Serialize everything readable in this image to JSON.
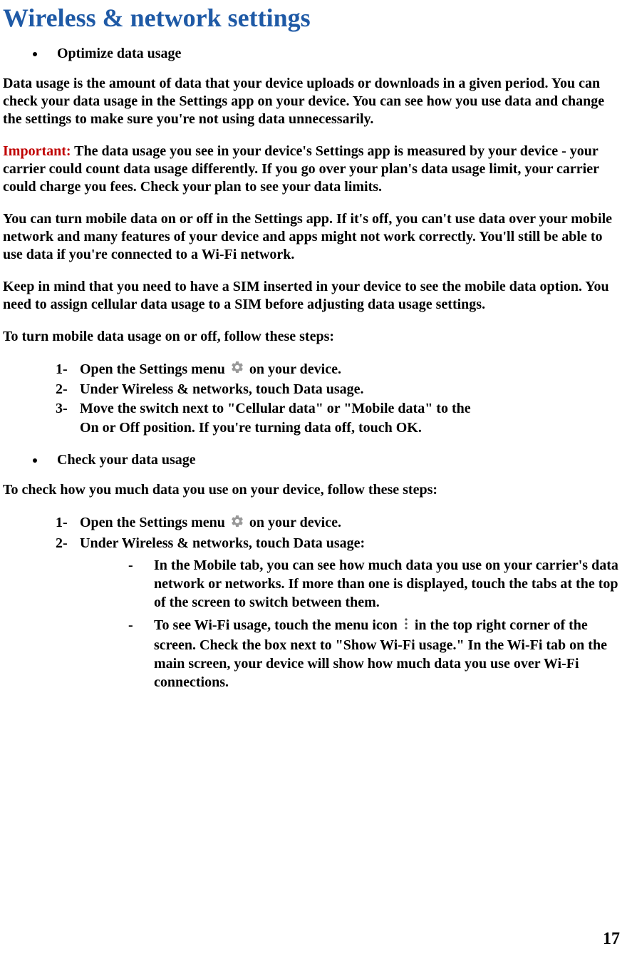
{
  "title": "Wireless & network settings",
  "bullets": {
    "optimize": "Optimize data usage",
    "check": "Check your data usage"
  },
  "paragraphs": {
    "intro": "Data usage is the amount of data that your device uploads or downloads in a given period. You can check your data usage in the Settings app on your device. You can see how you use data and change the settings to make sure you're not using data unnecessarily.",
    "important_label": "Important:",
    "important_body": " The data usage you see in your device's Settings app is measured by your device - your carrier could count data usage differently. If you go over your plan's data usage limit, your carrier could charge you fees. Check your plan to see your data limits.",
    "mobile_data": "You can turn mobile data on or off in the Settings app. If it's off, you can't use data over your mobile network and many features of your device and apps might not work correctly. You'll still be able to use data if you're connected to a Wi-Fi network.",
    "sim_note": "Keep in mind that you need to have a SIM inserted in your device to see the mobile data option. You need to assign cellular data usage to a SIM before adjusting data usage settings.",
    "turn_steps_intro": "To turn mobile data usage on or off, follow these steps:",
    "check_steps_intro": "To check how you much data you use on your device, follow these steps:"
  },
  "steps_turn": {
    "s1_a": "Open the Settings menu ",
    "s1_b": " on your device.",
    "s2": "Under Wireless & networks, touch Data usage.",
    "s3": "Move the switch next to \"Cellular data\" or \"Mobile data\" to the On or Off position. If you're turning data off, touch OK."
  },
  "steps_check": {
    "s1_a": "Open the Settings menu ",
    "s1_b": " on your device.",
    "s2": "Under Wireless & networks, touch Data usage:",
    "sub1": "In the Mobile tab, you can see how much data you use on your carrier's data network or networks. If more than one is displayed, touch the tabs at the top of the screen to switch between them.",
    "sub2_a": "To see Wi-Fi usage, touch the menu icon ",
    "sub2_b": " in the top right corner of the screen. Check the box next to \"Show Wi-Fi usage.\" In the Wi-Fi tab on the main screen, your device will show how much data you use over Wi-Fi connections."
  },
  "page_number": "17"
}
